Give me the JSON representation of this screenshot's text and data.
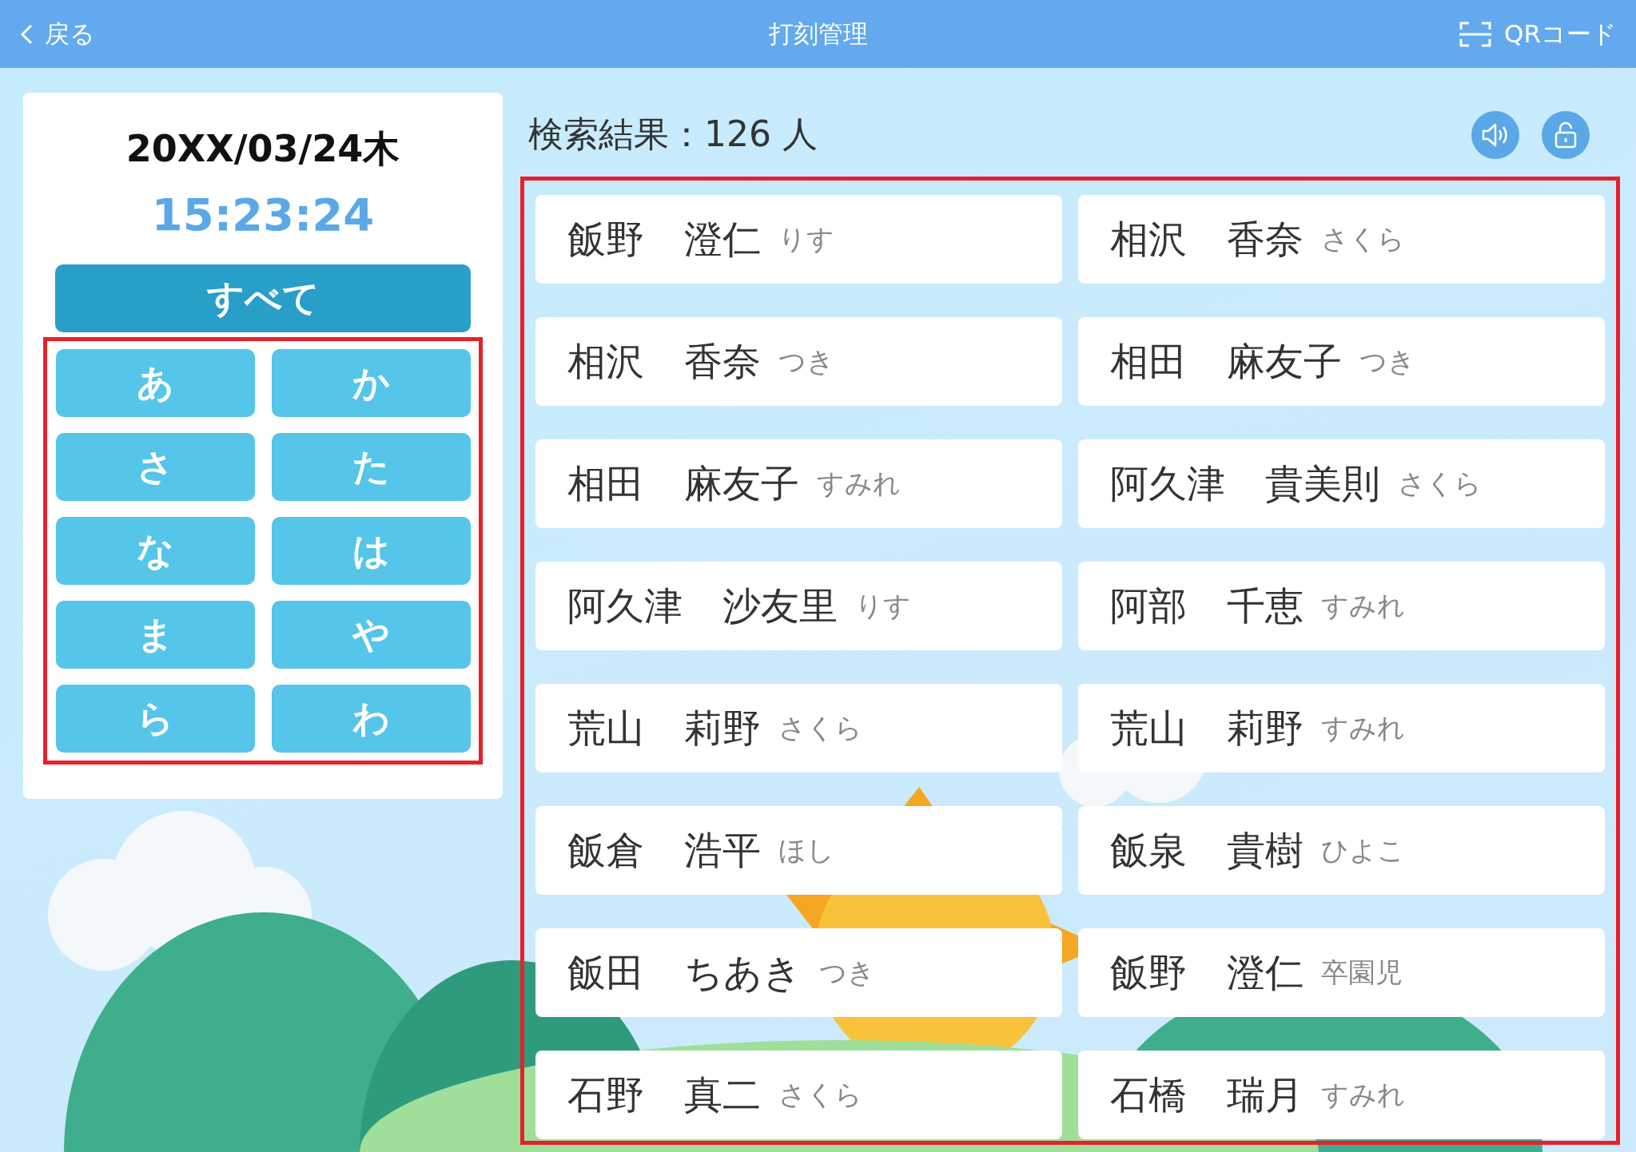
{
  "header": {
    "back": "戻る",
    "title": "打刻管理",
    "qr": "QRコード"
  },
  "clock": {
    "date": "20XX/03/24",
    "weekday": "木",
    "time": "15:23:24"
  },
  "all_button": "すべて",
  "kana_buttons": [
    "あ",
    "か",
    "さ",
    "た",
    "な",
    "は",
    "ま",
    "や",
    "ら",
    "わ"
  ],
  "results": {
    "label": "検索結果：126 人"
  },
  "people": [
    {
      "family": "飯野",
      "given": "澄仁",
      "group": "りす"
    },
    {
      "family": "相沢",
      "given": "香奈",
      "group": "さくら"
    },
    {
      "family": "相沢",
      "given": "香奈",
      "group": "つき"
    },
    {
      "family": "相田",
      "given": "麻友子",
      "group": "つき"
    },
    {
      "family": "相田",
      "given": "麻友子",
      "group": "すみれ"
    },
    {
      "family": "阿久津",
      "given": "貴美則",
      "group": "さくら"
    },
    {
      "family": "阿久津",
      "given": "沙友里",
      "group": "りす"
    },
    {
      "family": "阿部",
      "given": "千恵",
      "group": "すみれ"
    },
    {
      "family": "荒山",
      "given": "莉野",
      "group": "さくら"
    },
    {
      "family": "荒山",
      "given": "莉野",
      "group": "すみれ"
    },
    {
      "family": "飯倉",
      "given": "浩平",
      "group": "ほし"
    },
    {
      "family": "飯泉",
      "given": "貴樹",
      "group": "ひよこ"
    },
    {
      "family": "飯田",
      "given": "ちあき",
      "group": "つき"
    },
    {
      "family": "飯野",
      "given": "澄仁",
      "group": "卒園児"
    },
    {
      "family": "石野",
      "given": "真二",
      "group": "さくら"
    },
    {
      "family": "石橋",
      "given": "瑞月",
      "group": "すみれ"
    }
  ]
}
